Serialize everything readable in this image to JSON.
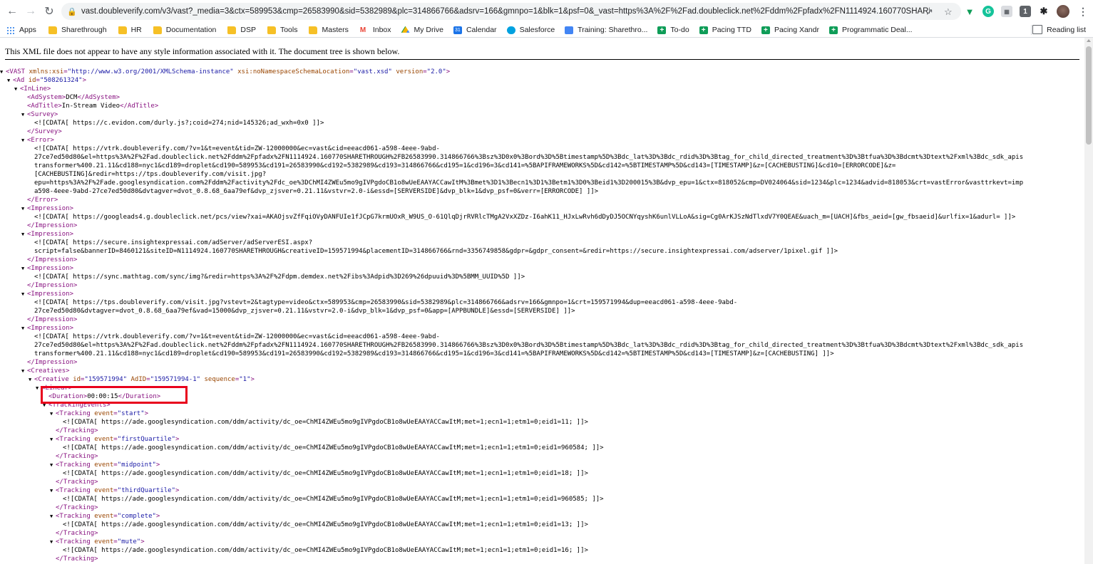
{
  "browser": {
    "url": "vast.doubleverify.com/v3/vast?_media=3&ctx=589953&cmp=26583990&sid=5382989&plc=314866766&adsrv=166&gmnpo=1&blk=1&psf=0&_vast=https%3A%2F%2Fad.doubleclick.net%2Fddm%2Fpfadx%2FN1114924.160770SHARET...",
    "bookmarks": [
      {
        "label": "Apps",
        "icon": "apps-icon"
      },
      {
        "label": "Sharethrough",
        "icon": "folder-icon"
      },
      {
        "label": "HR",
        "icon": "folder-icon"
      },
      {
        "label": "Documentation",
        "icon": "folder-icon"
      },
      {
        "label": "DSP",
        "icon": "folder-icon"
      },
      {
        "label": "Tools",
        "icon": "folder-icon"
      },
      {
        "label": "Masters",
        "icon": "folder-icon"
      },
      {
        "label": "Inbox",
        "icon": "gmail-icon"
      },
      {
        "label": "My Drive",
        "icon": "drive-icon"
      },
      {
        "label": "Calendar",
        "icon": "calendar-icon"
      },
      {
        "label": "Salesforce",
        "icon": "salesforce-icon"
      },
      {
        "label": "Training: Sharethro...",
        "icon": "docs-icon"
      },
      {
        "label": "To-do",
        "icon": "plus-icon"
      },
      {
        "label": "Pacing TTD",
        "icon": "plus-icon"
      },
      {
        "label": "Pacing Xandr",
        "icon": "plus-icon"
      },
      {
        "label": "Programmatic Deal...",
        "icon": "plus-icon"
      }
    ],
    "reading_list": "Reading list"
  },
  "viewer": {
    "info": "This XML file does not appear to have any style information associated with it. The document tree is shown below."
  },
  "xml_lines": [
    {
      "indent": 8,
      "arrow": "open",
      "html": "<span class='tag'>&lt;VAST</span> <span class='attr'>xmlns:xsi</span><span class='tag'>=</span><span class='val'>\"http://www.w3.org/2001/XMLSchema-instance\"</span> <span class='attr'>xsi:noNamespaceSchemaLocation</span><span class='tag'>=</span><span class='val'>\"vast.xsd\"</span> <span class='attr'>version</span><span class='tag'>=</span><span class='val'>\"2.0\"</span><span class='tag'>&gt;</span>"
    },
    {
      "indent": 18,
      "arrow": "open",
      "html": "<span class='tag'>&lt;Ad</span> <span class='attr'>id</span><span class='tag'>=</span><span class='val'>\"508261324\"</span><span class='tag'>&gt;</span>"
    },
    {
      "indent": 28,
      "arrow": "open",
      "html": "<span class='tag'>&lt;InLine&gt;</span>"
    },
    {
      "indent": 38,
      "arrow": "",
      "html": "<span class='tag'>&lt;AdSystem&gt;</span>DCM<span class='tag'>&lt;/AdSystem&gt;</span>"
    },
    {
      "indent": 38,
      "arrow": "",
      "html": "<span class='tag'>&lt;AdTitle&gt;</span>In-Stream Video<span class='tag'>&lt;/AdTitle&gt;</span>"
    },
    {
      "indent": 38,
      "arrow": "open",
      "html": "<span class='tag'>&lt;Survey&gt;</span>"
    },
    {
      "indent": 48,
      "arrow": "",
      "html": "&lt;![CDATA[ https://c.evidon.com/durly.js?;coid=274;nid=145326;ad_wxh=0x0 ]]&gt;"
    },
    {
      "indent": 38,
      "arrow": "",
      "html": "<span class='tag'>&lt;/Survey&gt;</span>"
    },
    {
      "indent": 38,
      "arrow": "open",
      "html": "<span class='tag'>&lt;Error&gt;</span>"
    },
    {
      "indent": 48,
      "arrow": "",
      "html": "&lt;![CDATA[ https://vtrk.doubleverify.com/?v=1&amp;t=event&amp;tid=ZW-12000000&amp;ec=vast&amp;cid=eeacd061-a598-4eee-9abd-"
    },
    {
      "indent": 48,
      "arrow": "",
      "html": "27ce7ed50d80&amp;el=https%3A%2F%2Fad.doubleclick.net%2Fddm%2Fpfadx%2FN1114924.160770SHARETHROUGH%2FB26583990.314866766%3Bsz%3D0x0%3Bord%3D%5Btimestamp%5D%3Bdc_lat%3D%3Bdc_rdid%3D%3Btag_for_child_directed_treatment%3D%3Btfua%3D%3Bdcmt%3Dtext%2Fxml%3Bdc_sdk_apis"
    },
    {
      "indent": 48,
      "arrow": "",
      "html": "transformer%400.21.11&amp;cd188=nyc1&amp;cd189=droplet&amp;cd190=589953&amp;cd191=26583990&amp;cd192=5382989&amp;cd193=314866766&amp;cd195=1&amp;cd196=3&amp;cd141=%5BAPIFRAMEWORKS%5D&amp;cd142=%5BTIMESTAMP%5D&amp;cd143=[TIMESTAMP]&amp;z=[CACHEBUSTING]&amp;cd10=[ERRORCODE]&amp;z="
    },
    {
      "indent": 48,
      "arrow": "",
      "html": "[CACHEBUSTING]&amp;redir=https://tps.doubleverify.com/visit.jpg?"
    },
    {
      "indent": 48,
      "arrow": "",
      "html": "epu=https%3A%2F%2Fade.googlesyndication.com%2Fddm%2Factivity%2Fdc_oe%3DChMI4ZWEu5mo9gIVPgdoCB1o8wUeEAAYACCawItM%3Bmet%3D1%3Becn1%3D1%3Betm1%3D0%3Beid1%3D200015%3B&amp;dvp_epu=1&amp;ctx=818052&amp;cmp=DV024064&amp;sid=1234&amp;plc=1234&amp;advid=818053&amp;crt=vastError&amp;vasttrkevt=imp"
    },
    {
      "indent": 48,
      "arrow": "",
      "html": "a598-4eee-9abd-27ce7ed50d80&amp;dvtagver=dvot_0.8.68_6aa79ef&amp;dvp_zjsver=0.21.11&amp;vstvr=2.0-i&amp;essd=[SERVERSIDE]&amp;dvp_blk=1&amp;dvp_psf=0&amp;verr=[ERRORCODE] ]]&gt;"
    },
    {
      "indent": 38,
      "arrow": "",
      "html": "<span class='tag'>&lt;/Error&gt;</span>"
    },
    {
      "indent": 38,
      "arrow": "open",
      "html": "<span class='tag'>&lt;Impression&gt;</span>"
    },
    {
      "indent": 48,
      "arrow": "",
      "html": "&lt;![CDATA[ https://googleads4.g.doubleclick.net/pcs/view?xai=AKAOjsvZfFqiOVyDANFUIe1fJCpG7krmUOxR_W9US_O-61QlqDjrRVRlcTMgA2VxXZDz-I6ahK11_HJxLwRvh6dDyDJ5OCNYqyshK6unlVLLoA&amp;sig=Cg0ArKJSzNdTlxdV7Y0QEAE&amp;uach_m=[UACH]&amp;fbs_aeid=[gw_fbsaeid]&amp;urlfix=1&amp;adurl= ]]&gt;"
    },
    {
      "indent": 38,
      "arrow": "",
      "html": "<span class='tag'>&lt;/Impression&gt;</span>"
    },
    {
      "indent": 38,
      "arrow": "open",
      "html": "<span class='tag'>&lt;Impression&gt;</span>"
    },
    {
      "indent": 48,
      "arrow": "",
      "html": "&lt;![CDATA[ https://secure.insightexpressai.com/adServer/adServerESI.aspx?"
    },
    {
      "indent": 48,
      "arrow": "",
      "html": "script=false&amp;bannerID=8460121&amp;siteID=N1114924.160770SHARETHROUGH&amp;creativeID=159571994&amp;placementID=314866766&amp;rnd=3356749858&amp;gdpr=&amp;gdpr_consent=&amp;redir=https://secure.insightexpressai.com/adserver/1pixel.gif ]]&gt;"
    },
    {
      "indent": 38,
      "arrow": "",
      "html": "<span class='tag'>&lt;/Impression&gt;</span>"
    },
    {
      "indent": 38,
      "arrow": "open",
      "html": "<span class='tag'>&lt;Impression&gt;</span>"
    },
    {
      "indent": 48,
      "arrow": "",
      "html": "&lt;![CDATA[ https://sync.mathtag.com/sync/img?&amp;redir=https%3A%2F%2Fdpm.demdex.net%2Fibs%3Adpid%3D269%26dpuuid%3D%5BMM_UUID%5D ]]&gt;"
    },
    {
      "indent": 38,
      "arrow": "",
      "html": "<span class='tag'>&lt;/Impression&gt;</span>"
    },
    {
      "indent": 38,
      "arrow": "open",
      "html": "<span class='tag'>&lt;Impression&gt;</span>"
    },
    {
      "indent": 48,
      "arrow": "",
      "html": "&lt;![CDATA[ https://tps.doubleverify.com/visit.jpg?vstevt=2&amp;tagtype=video&amp;ctx=589953&amp;cmp=26583990&amp;sid=5382989&amp;plc=314866766&amp;adsrv=166&amp;gmnpo=1&amp;crt=159571994&amp;dup=eeacd061-a598-4eee-9abd-"
    },
    {
      "indent": 48,
      "arrow": "",
      "html": "27ce7ed50d80&amp;dvtagver=dvot_0.8.68_6aa79ef&amp;vad=15000&amp;dvp_zjsver=0.21.11&amp;vstvr=2.0-i&amp;dvp_blk=1&amp;dvp_psf=0&amp;app=[APPBUNDLE]&amp;essd=[SERVERSIDE] ]]&gt;"
    },
    {
      "indent": 38,
      "arrow": "",
      "html": "<span class='tag'>&lt;/Impression&gt;</span>"
    },
    {
      "indent": 38,
      "arrow": "open",
      "html": "<span class='tag'>&lt;Impression&gt;</span>"
    },
    {
      "indent": 48,
      "arrow": "",
      "html": "&lt;![CDATA[ https://vtrk.doubleverify.com/?v=1&amp;t=event&amp;tid=ZW-12000000&amp;ec=vast&amp;cid=eeacd061-a598-4eee-9abd-"
    },
    {
      "indent": 48,
      "arrow": "",
      "html": "27ce7ed50d80&amp;el=https%3A%2F%2Fad.doubleclick.net%2Fddm%2Fpfadx%2FN1114924.160770SHARETHROUGH%2FB26583990.314866766%3Bsz%3D0x0%3Bord%3D%5Btimestamp%5D%3Bdc_lat%3D%3Bdc_rdid%3D%3Btag_for_child_directed_treatment%3D%3Btfua%3D%3Bdcmt%3Dtext%2Fxml%3Bdc_sdk_apis"
    },
    {
      "indent": 48,
      "arrow": "",
      "html": "transformer%400.21.11&amp;cd188=nyc1&amp;cd189=droplet&amp;cd190=589953&amp;cd191=26583990&amp;cd192=5382989&amp;cd193=314866766&amp;cd195=1&amp;cd196=3&amp;cd141=%5BAPIFRAMEWORKS%5D&amp;cd142=%5BTIMESTAMP%5D&amp;cd143=[TIMESTAMP]&amp;z=[CACHEBUSTING] ]]&gt;"
    },
    {
      "indent": 38,
      "arrow": "",
      "html": "<span class='tag'>&lt;/Impression&gt;</span>"
    },
    {
      "indent": 38,
      "arrow": "open",
      "html": "<span class='tag'>&lt;Creatives&gt;</span>"
    },
    {
      "indent": 48,
      "arrow": "open",
      "html": "<span class='tag'>&lt;Creative</span> <span class='attr'>id</span><span class='tag'>=</span><span class='val'>\"159571994\"</span> <span class='attr'>AdID</span><span class='tag'>=</span><span class='val'>\"159571994-1\"</span> <span class='attr'>sequence</span><span class='tag'>=</span><span class='val'>\"1\"</span><span class='tag'>&gt;</span>"
    },
    {
      "indent": 58,
      "arrow": "open",
      "html": "<span class='tag'>&lt;Linear&gt;</span>"
    },
    {
      "indent": 68,
      "arrow": "",
      "html": "<span class='tag'>&lt;Duration&gt;</span>00:00:15<span class='tag'>&lt;/Duration&gt;</span>"
    },
    {
      "indent": 68,
      "arrow": "open",
      "html": "<span class='tag'>&lt;TrackingEvents&gt;</span>"
    },
    {
      "indent": 78,
      "arrow": "open",
      "html": "<span class='tag'>&lt;Tracking</span> <span class='attr'>event</span><span class='tag'>=</span><span class='val'>\"start\"</span><span class='tag'>&gt;</span>"
    },
    {
      "indent": 88,
      "arrow": "",
      "html": "&lt;![CDATA[ https://ade.googlesyndication.com/ddm/activity/dc_oe=ChMI4ZWEu5mo9gIVPgdoCB1o8wUeEAAYACCawItM;met=1;ecn1=1;etm1=0;eid1=11; ]]&gt;"
    },
    {
      "indent": 78,
      "arrow": "",
      "html": "<span class='tag'>&lt;/Tracking&gt;</span>"
    },
    {
      "indent": 78,
      "arrow": "open",
      "html": "<span class='tag'>&lt;Tracking</span> <span class='attr'>event</span><span class='tag'>=</span><span class='val'>\"firstQuartile\"</span><span class='tag'>&gt;</span>"
    },
    {
      "indent": 88,
      "arrow": "",
      "html": "&lt;![CDATA[ https://ade.googlesyndication.com/ddm/activity/dc_oe=ChMI4ZWEu5mo9gIVPgdoCB1o8wUeEAAYACCawItM;met=1;ecn1=1;etm1=0;eid1=960584; ]]&gt;"
    },
    {
      "indent": 78,
      "arrow": "",
      "html": "<span class='tag'>&lt;/Tracking&gt;</span>"
    },
    {
      "indent": 78,
      "arrow": "open",
      "html": "<span class='tag'>&lt;Tracking</span> <span class='attr'>event</span><span class='tag'>=</span><span class='val'>\"midpoint\"</span><span class='tag'>&gt;</span>"
    },
    {
      "indent": 88,
      "arrow": "",
      "html": "&lt;![CDATA[ https://ade.googlesyndication.com/ddm/activity/dc_oe=ChMI4ZWEu5mo9gIVPgdoCB1o8wUeEAAYACCawItM;met=1;ecn1=1;etm1=0;eid1=18; ]]&gt;"
    },
    {
      "indent": 78,
      "arrow": "",
      "html": "<span class='tag'>&lt;/Tracking&gt;</span>"
    },
    {
      "indent": 78,
      "arrow": "open",
      "html": "<span class='tag'>&lt;Tracking</span> <span class='attr'>event</span><span class='tag'>=</span><span class='val'>\"thirdQuartile\"</span><span class='tag'>&gt;</span>"
    },
    {
      "indent": 88,
      "arrow": "",
      "html": "&lt;![CDATA[ https://ade.googlesyndication.com/ddm/activity/dc_oe=ChMI4ZWEu5mo9gIVPgdoCB1o8wUeEAAYACCawItM;met=1;ecn1=1;etm1=0;eid1=960585; ]]&gt;"
    },
    {
      "indent": 78,
      "arrow": "",
      "html": "<span class='tag'>&lt;/Tracking&gt;</span>"
    },
    {
      "indent": 78,
      "arrow": "open",
      "html": "<span class='tag'>&lt;Tracking</span> <span class='attr'>event</span><span class='tag'>=</span><span class='val'>\"complete\"</span><span class='tag'>&gt;</span>"
    },
    {
      "indent": 88,
      "arrow": "",
      "html": "&lt;![CDATA[ https://ade.googlesyndication.com/ddm/activity/dc_oe=ChMI4ZWEu5mo9gIVPgdoCB1o8wUeEAAYACCawItM;met=1;ecn1=1;etm1=0;eid1=13; ]]&gt;"
    },
    {
      "indent": 78,
      "arrow": "",
      "html": "<span class='tag'>&lt;/Tracking&gt;</span>"
    },
    {
      "indent": 78,
      "arrow": "open",
      "html": "<span class='tag'>&lt;Tracking</span> <span class='attr'>event</span><span class='tag'>=</span><span class='val'>\"mute\"</span><span class='tag'>&gt;</span>"
    },
    {
      "indent": 88,
      "arrow": "",
      "html": "&lt;![CDATA[ https://ade.googlesyndication.com/ddm/activity/dc_oe=ChMI4ZWEu5mo9gIVPgdoCB1o8wUeEAAYACCawItM;met=1;ecn1=1;etm1=0;eid1=16; ]]&gt;"
    },
    {
      "indent": 78,
      "arrow": "",
      "html": "<span class='tag'>&lt;/Tracking&gt;</span>"
    }
  ],
  "colors": {
    "tag": "#881280",
    "attribute": "#994500",
    "value": "#1a1aa6",
    "highlight": "#e8001c"
  }
}
